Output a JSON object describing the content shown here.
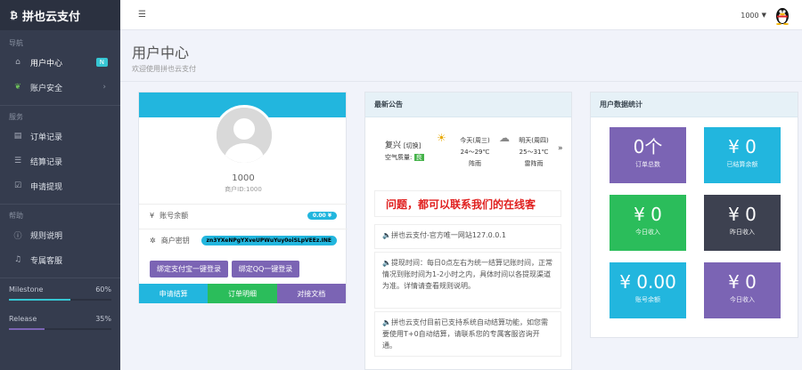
{
  "app": {
    "title": "拼也云支付"
  },
  "sidebar": {
    "section_nav": "导航",
    "section_service": "服务",
    "section_help": "帮助",
    "items": [
      {
        "label": "用户中心",
        "badge": "N",
        "icon": "home-icon"
      },
      {
        "label": "账户安全",
        "icon": "leaf-icon"
      },
      {
        "label": "订单记录",
        "icon": "list-icon"
      },
      {
        "label": "结算记录",
        "icon": "list-icon"
      },
      {
        "label": "申请提现",
        "icon": "check-icon"
      },
      {
        "label": "规则说明",
        "icon": "info-icon"
      },
      {
        "label": "专属客服",
        "icon": "bell-icon"
      }
    ],
    "progress": [
      {
        "label": "Milestone",
        "value": "60%",
        "fraction": 0.6
      },
      {
        "label": "Release",
        "value": "35%",
        "fraction": 0.35
      }
    ]
  },
  "topbar": {
    "user": "1000"
  },
  "header": {
    "title": "用户中心",
    "subtitle": "欢迎使用拼也云支付"
  },
  "profile": {
    "name": "1000",
    "uid": "商户ID:1000",
    "balance_label": "账号余额",
    "balance_value": "0.00 ¥",
    "key_label": "商户密钥",
    "key_value": "zn3YXeNPgYXveUPWuYuy0oiSLpVEEz.INE",
    "bind_alipay": "绑定支付宝一键登录",
    "bind_qq": "绑定QQ一键登录",
    "tabs": [
      "申请结算",
      "订单明细",
      "对接文档"
    ]
  },
  "notice": {
    "title": "最新公告",
    "weather": {
      "city": "复兴",
      "switch": "[切换]",
      "aq_label": "空气质量:",
      "aq_value": "良",
      "today_label": "今天(周三)",
      "today_temp": "24～29℃",
      "today_desc": "阵雨",
      "tomorrow_label": "明天(周四)",
      "tomorrow_temp": "25～31℃",
      "tomorrow_desc": "雷阵雨",
      "more": "»"
    },
    "marquee": "问题，都可以联系我们的在线客",
    "announcements": [
      "🔈拼也云支付-官方唯一网站127.0.0.1",
      "🔈提现时间：每日0点左右为统一结算记账时间，正常情况到账时间为1-2小时之内，具体时间以各提现渠道为准。详情请查看规则说明。",
      "🔈拼也云支付目前已支持系统自动结算功能，如您需要使用T+0自动结算，请联系您的专属客服咨询开通。"
    ]
  },
  "stats": {
    "title": "用户数据统计",
    "items": [
      {
        "value": "0个",
        "label": "订单总数",
        "color": "#7b64b4"
      },
      {
        "value": "¥ 0",
        "label": "已结算余额",
        "color": "#22b6de"
      },
      {
        "value": "¥ 0",
        "label": "今日收入",
        "color": "#2bbd5b"
      },
      {
        "value": "¥ 0",
        "label": "昨日收入",
        "color": "#3d4150"
      },
      {
        "value": "¥ 0.00",
        "label": "账号余额",
        "color": "#22b6de"
      },
      {
        "value": "¥ 0",
        "label": "今日收入",
        "color": "#7b64b4"
      }
    ]
  }
}
